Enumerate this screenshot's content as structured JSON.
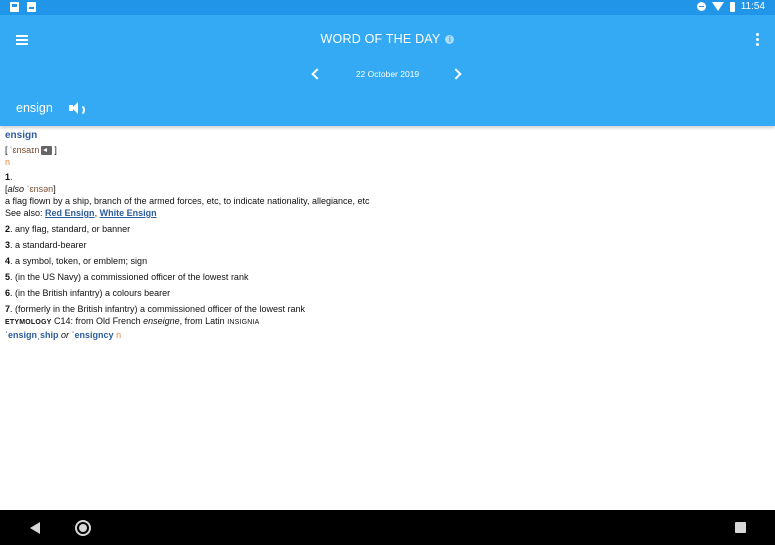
{
  "status_bar": {
    "time": "11:54",
    "left_icons": [
      "phone-icon",
      "image-icon"
    ],
    "right_icons": [
      "do-not-disturb-icon",
      "wifi-icon",
      "battery-icon"
    ]
  },
  "app_bar": {
    "title": "WORD OF THE DAY",
    "date": "22 October 2019",
    "word": "ensign"
  },
  "entry": {
    "headword": "ensign",
    "pron_open": "[",
    "pron_ipa": "ˈɛnsaɪn",
    "pron_close": "]",
    "pos": "n",
    "sense1": {
      "num": "1",
      "dot": ".",
      "alt_open": "[",
      "alt_italic": "also",
      "alt_ipa": "ˈɛnsən",
      "alt_close": "]",
      "def": "a flag flown by a ship, branch of the armed forces, etc, to indicate nationality, allegiance, etc",
      "see_also": "See also:",
      "link1": "Red Ensign",
      "sep": ",",
      "link2": "White Ensign"
    },
    "senses": [
      {
        "num": "2",
        "text": ". any flag, standard, or banner"
      },
      {
        "num": "3",
        "text": ". a standard-bearer"
      },
      {
        "num": "4",
        "text": ". a symbol, token, or emblem; sign"
      },
      {
        "num": "5",
        "text": ". (in the US Navy) a commissioned officer of the lowest rank"
      },
      {
        "num": "6",
        "text": ". (in the British infantry) a colours bearer"
      },
      {
        "num": "7",
        "text": ". (formerly in the British infantry) a commissioned officer of the lowest rank"
      }
    ],
    "etymology": {
      "label": "ETYMOLOGY",
      "text1": "C14: from Old French",
      "italic": "enseigne",
      "text2": ", from Latin",
      "smallcaps": "INSIGNIA"
    },
    "derived": {
      "word1": "ˈensignˌship",
      "or": "or",
      "word2": "ˈensigncy",
      "pos": "n"
    }
  },
  "nav_bar": {
    "icons": [
      "back-icon",
      "home-icon",
      "recents-icon"
    ]
  }
}
